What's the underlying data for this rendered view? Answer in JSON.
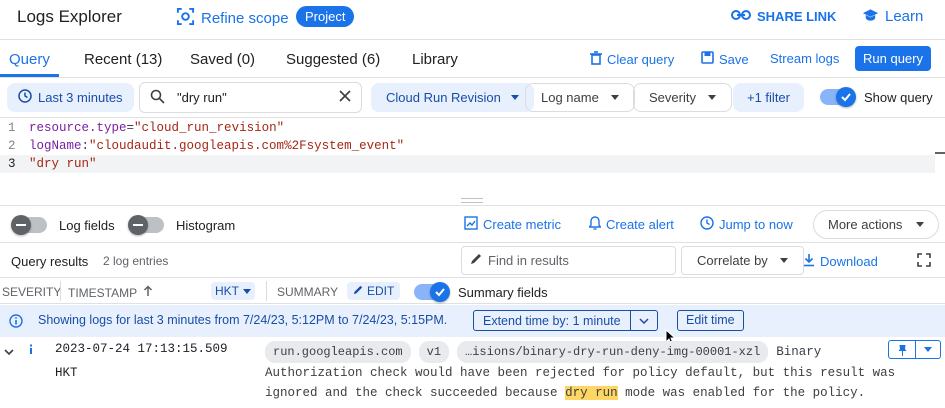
{
  "header": {
    "title": "Logs Explorer",
    "refine_label": "Refine scope",
    "scope_badge": "Project",
    "share_label": "SHARE LINK",
    "learn_label": "Learn"
  },
  "tabs": [
    {
      "label": "Query"
    },
    {
      "label": "Recent (13)"
    },
    {
      "label": "Saved (0)"
    },
    {
      "label": "Suggested (6)"
    },
    {
      "label": "Library"
    }
  ],
  "toolbar": {
    "clear_label": "Clear query",
    "save_label": "Save",
    "stream_label": "Stream logs",
    "run_label": "Run query"
  },
  "filters": {
    "time_label": "Last 3 minutes",
    "search_value": "\"dry run\"",
    "resource_label": "Cloud Run Revision",
    "logname_label": "Log name",
    "severity_label": "Severity",
    "more_filter_label": "+1 filter",
    "show_query_label": "Show query"
  },
  "editor": {
    "lines": [
      {
        "num": "1",
        "key": "resource.type",
        "op": "=",
        "val": "\"cloud_run_revision\""
      },
      {
        "num": "2",
        "key": "logName",
        "op": ":",
        "val": "\"cloudaudit.googleapis.com%2Fsystem_event\""
      },
      {
        "num": "3",
        "key": "",
        "op": "",
        "val": "\"dry run\""
      }
    ]
  },
  "actions": {
    "log_fields_label": "Log fields",
    "histogram_label": "Histogram",
    "create_metric_label": "Create metric",
    "create_alert_label": "Create alert",
    "jump_label": "Jump to now",
    "more_actions_label": "More actions"
  },
  "results": {
    "title": "Query results",
    "count": "2 log entries",
    "find_placeholder": "Find in results",
    "correlate_label": "Correlate by",
    "download_label": "Download"
  },
  "columns": {
    "severity": "SEVERITY",
    "timestamp": "TIMESTAMP",
    "timezone": "HKT",
    "summary": "SUMMARY",
    "edit": "EDIT",
    "summary_fields": "Summary fields"
  },
  "banner": {
    "text": "Showing logs for last 3 minutes from 7/24/23, 5:12PM to 7/24/23, 5:15PM.",
    "extend_label": "Extend time by: 1 minute",
    "edit_time_label": "Edit time"
  },
  "entry": {
    "timestamp": "2023-07-24 17:13:15.509",
    "tz": "HKT",
    "chip1": "run.googleapis.com",
    "chip2": "v1",
    "chip3": "…isions/binary-dry-run-deny-img-00001-xzl",
    "msg_first": "Binary",
    "msg_line2": "Authorization check would have been rejected for policy default, but this result was",
    "msg_line3_pre": "ignored and the check succeeded because ",
    "msg_highlight": "dry run",
    "msg_line3_post": " mode was enabled for the policy."
  },
  "colors": {
    "accent": "#1a73e8",
    "chip_blue_bg": "#e8f0fe",
    "banner_bg": "#e8f0fe",
    "highlight": "#fdd663"
  }
}
